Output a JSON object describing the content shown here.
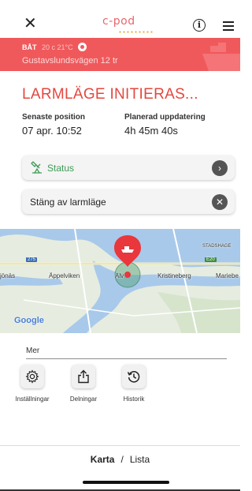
{
  "header": {
    "close_icon": "close-icon",
    "logo_text": "c-pod",
    "info_icon": "info-icon",
    "menu_icon": "hamburger-menu-icon"
  },
  "banner": {
    "kind": "BÅT",
    "weather": "20 c  21°C",
    "address": "Gustavslundsvägen 12 tr",
    "color": "#f0595b"
  },
  "alarm": {
    "title": "LARMLÄGE INITIERAS...",
    "last_position_label": "Senaste position",
    "last_position_value": "07 apr. 10:52",
    "planned_update_label": "Planerad uppdatering",
    "planned_update_value": "4h 45m 40s",
    "accent_color": "#e4473f"
  },
  "actions": {
    "status_label": "Status",
    "status_color": "#3e9b55",
    "stop_label": "Stäng av larmläge"
  },
  "map": {
    "places": [
      "jönäs",
      "Äppelviken",
      "Alv",
      "Kristineberg",
      "Mariebe",
      "STADSHAGE"
    ],
    "shields": [
      "275",
      "E20"
    ],
    "attribution": "Google"
  },
  "more": {
    "label": "Mer",
    "tools": [
      {
        "label": "Inställningar",
        "icon": "settings-gear-icon"
      },
      {
        "label": "Delningar",
        "icon": "share-icon"
      },
      {
        "label": "Historik",
        "icon": "history-icon"
      }
    ]
  },
  "view_switch": {
    "map": "Karta",
    "separator": "/",
    "list": "Lista"
  }
}
